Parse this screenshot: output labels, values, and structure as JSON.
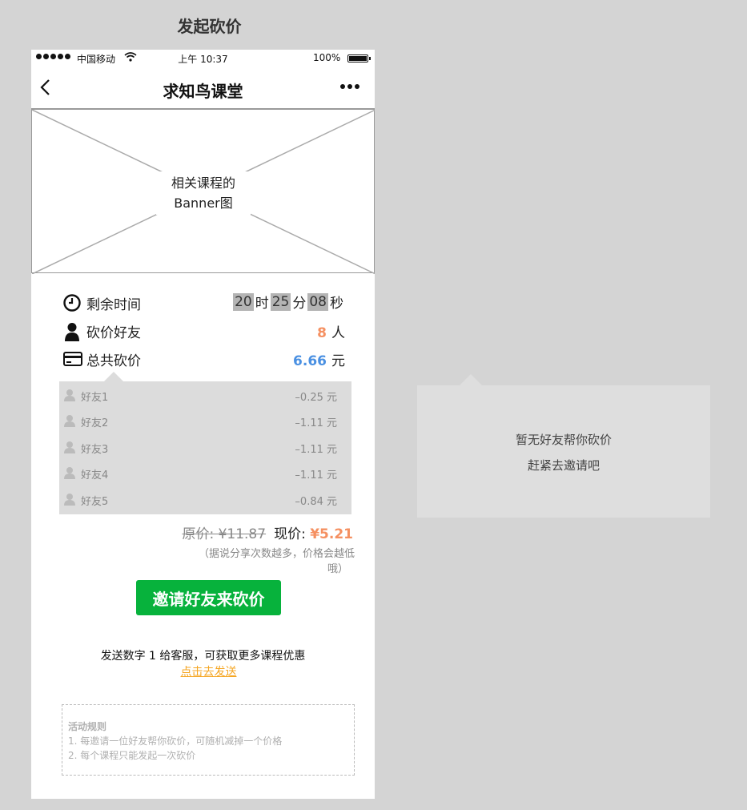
{
  "page_title": "发起砍价",
  "status_bar": {
    "carrier": "中国移动",
    "time": "上午 10:37",
    "battery": "100%"
  },
  "navbar": {
    "title": "求知鸟课堂"
  },
  "banner": {
    "line1": "相关课程的",
    "line2": "Banner图"
  },
  "info": {
    "time_label": "剩余时间",
    "countdown": {
      "hours": "20",
      "hours_unit": "时",
      "minutes": "25",
      "minutes_unit": "分",
      "seconds": "08",
      "seconds_unit": "秒"
    },
    "friends_label": "砍价好友",
    "friends_count": "8",
    "friends_unit": "人",
    "total_label": "总共砍价",
    "total_amount": "6.66",
    "total_unit": "元"
  },
  "friends": [
    {
      "name": "好友1",
      "amount": "–0.25 元"
    },
    {
      "name": "好友2",
      "amount": "–1.11 元"
    },
    {
      "name": "好友3",
      "amount": "–1.11 元"
    },
    {
      "name": "好友4",
      "amount": "–1.11 元"
    },
    {
      "name": "好友5",
      "amount": "–0.84 元"
    }
  ],
  "price": {
    "original": "原价: ¥11.87",
    "now_label": "现价: ",
    "now_value": "¥5.21",
    "note_line1": "（据说分享次数越多，价格会越低",
    "note_line2": "哦）"
  },
  "invite_button": "邀请好友来砍价",
  "send": {
    "text": "发送数字 1 给客服，可获取更多课程优惠",
    "link": "点击去发送"
  },
  "rules": {
    "title": "活动规则",
    "item1": "1.  每邀请一位好友帮你砍价，可随机减掉一个价格",
    "item2": "2. 每个课程只能发起一次砍价"
  },
  "empty_state": {
    "line1": "暂无好友帮你砍价",
    "line2": "赶紧去邀请吧"
  },
  "colors": {
    "accent_green": "#07b23c",
    "orange": "#f59061",
    "blue": "#4a90e2",
    "link": "#f5a623"
  }
}
